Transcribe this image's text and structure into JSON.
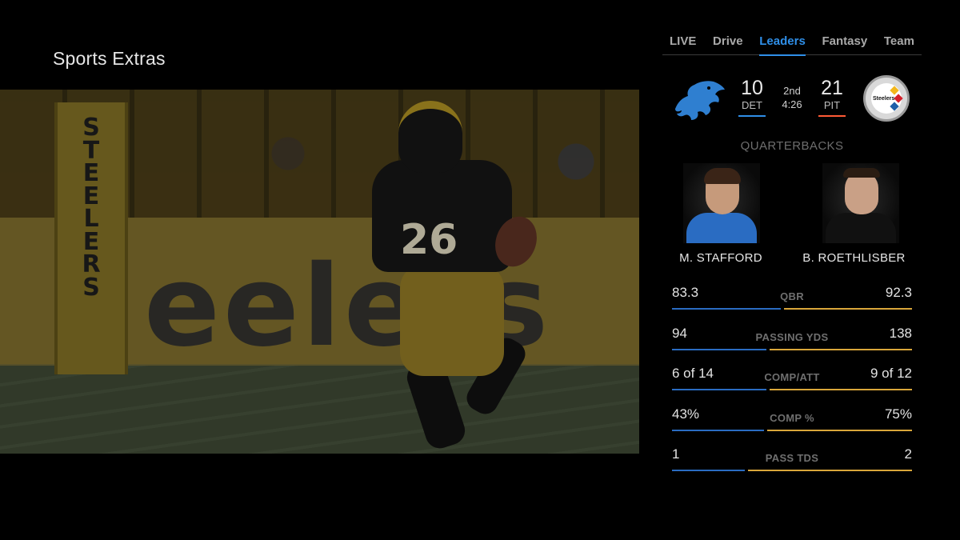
{
  "app": {
    "title": "Sports Extras"
  },
  "tabs": [
    {
      "label": "LIVE",
      "active": false
    },
    {
      "label": "Drive",
      "active": false
    },
    {
      "label": "Leaders",
      "active": true
    },
    {
      "label": "Fantasy",
      "active": false
    },
    {
      "label": "Team",
      "active": false
    }
  ],
  "game": {
    "away": {
      "abbr": "DET",
      "score": "10",
      "color": "#2f8fe8",
      "logo": "lions-logo"
    },
    "home": {
      "abbr": "PIT",
      "score": "21",
      "color": "#ff5a36",
      "logo": "steelers-logo",
      "logo_text": "Steelers"
    },
    "period": "2nd",
    "clock": "4:26"
  },
  "leaders": {
    "section_title": "QUARTERBACKS",
    "away_player": {
      "name": "M. STAFFORD",
      "jersey_color": "#2a6cc2"
    },
    "home_player": {
      "name": "B. ROETHLISBER",
      "jersey_color": "#111111"
    },
    "colors": {
      "away": "#2a6cc2",
      "home": "#d9a63a"
    },
    "stats": [
      {
        "label": "QBR",
        "away": "83.3",
        "home": "92.3",
        "away_share": 0.46
      },
      {
        "label": "PASSING YDS",
        "away": "94",
        "home": "138",
        "away_share": 0.4
      },
      {
        "label": "COMP/ATT",
        "away": "6 of 14",
        "home": "9 of 12",
        "away_share": 0.4
      },
      {
        "label": "COMP %",
        "away": "43%",
        "home": "75%",
        "away_share": 0.39
      },
      {
        "label": "PASS TDS",
        "away": "1",
        "home": "2",
        "away_share": 0.31
      }
    ]
  },
  "video": {
    "post_text": "STEELERS",
    "banner_text": "eelers",
    "jersey_number": "26"
  }
}
